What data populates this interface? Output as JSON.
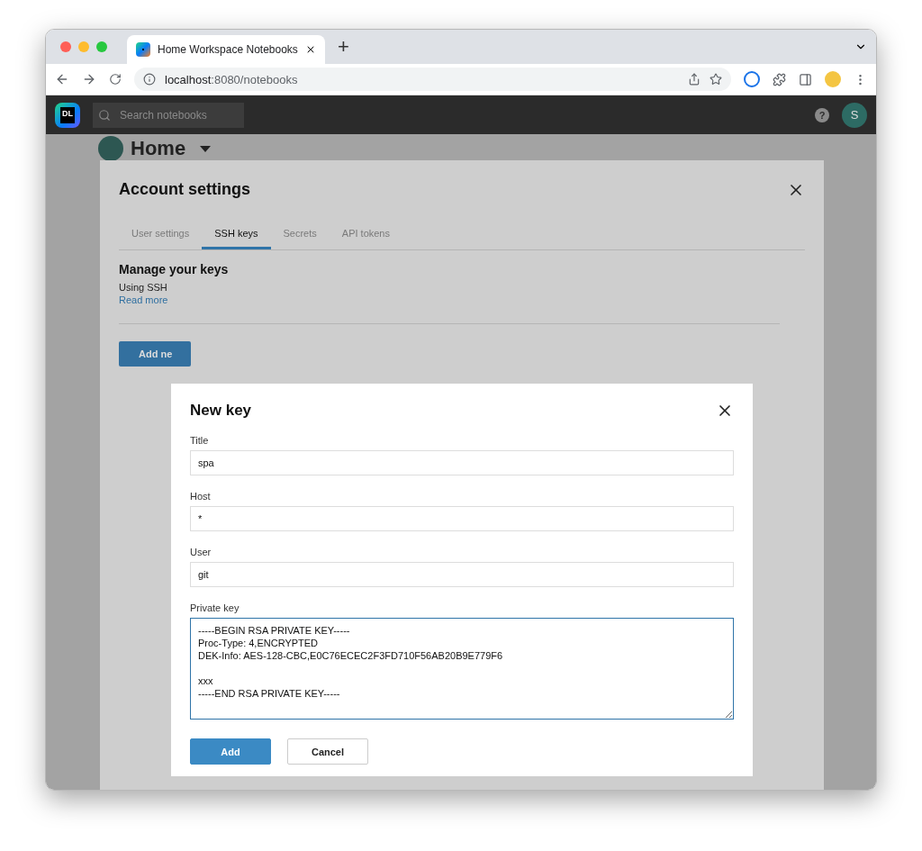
{
  "browser": {
    "tab_title": "Home Workspace Notebooks",
    "url_host": "localhost",
    "url_path": ":8080/notebooks",
    "new_tab": "+"
  },
  "app_header": {
    "logo": "DL",
    "search": {
      "placeholder": "Search notebooks"
    },
    "help": "?",
    "avatar": "S"
  },
  "page": {
    "title": "Home"
  },
  "account_settings": {
    "title": "Account settings",
    "tabs": [
      {
        "label": "User settings",
        "selected": false
      },
      {
        "label": "SSH keys",
        "selected": true
      },
      {
        "label": "Secrets",
        "selected": false
      },
      {
        "label": "API tokens",
        "selected": false
      }
    ],
    "section_title": "Manage your keys",
    "description": "Using SSH",
    "read_more": "Read more",
    "add_button": "Add ne"
  },
  "new_key": {
    "title": "New key",
    "fields": [
      {
        "label": "Title",
        "value": "spa",
        "focused": false
      },
      {
        "label": "Host",
        "value": "*",
        "focused": false
      },
      {
        "label": "User",
        "value": "git",
        "focused": false
      }
    ],
    "private_key": {
      "label": "Private key",
      "value": "-----BEGIN RSA PRIVATE KEY-----\nProc-Type: 4,ENCRYPTED\nDEK-Info: AES-128-CBC,E0C76ECEC2F3FD710F56AB20B9E779F6\n\nxxx\n-----END RSA PRIVATE KEY-----",
      "focused": true
    },
    "buttons": [
      {
        "label": "Add",
        "kind": "primary"
      },
      {
        "label": "Cancel",
        "kind": "secondary"
      }
    ]
  }
}
